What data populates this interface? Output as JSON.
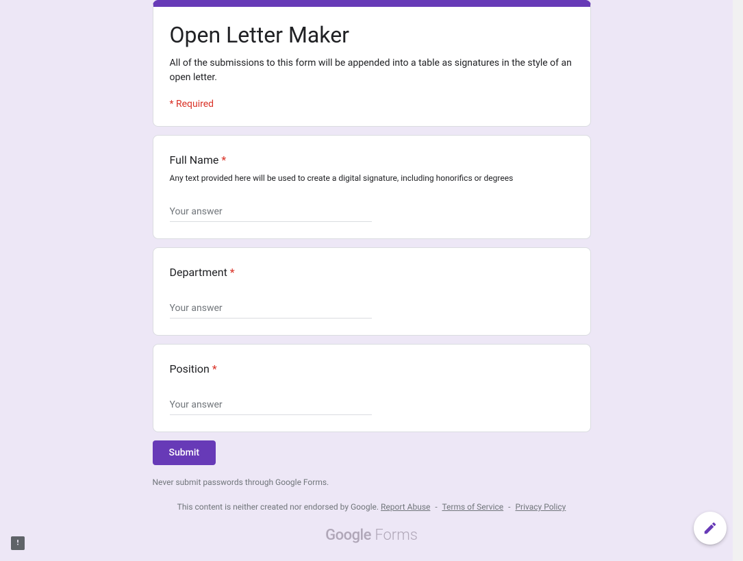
{
  "header": {
    "title": "Open Letter Maker",
    "description": "All of the submissions to this form will be appended into a table as signatures in the style of an open letter.",
    "required_note": "* Required"
  },
  "questions": [
    {
      "label": "Full Name",
      "required": true,
      "helper": "Any text provided here will be used to create a digital signature, including honorifics or degrees",
      "placeholder": "Your answer"
    },
    {
      "label": "Department",
      "required": true,
      "helper": "",
      "placeholder": "Your answer"
    },
    {
      "label": "Position",
      "required": true,
      "helper": "",
      "placeholder": "Your answer"
    }
  ],
  "actions": {
    "submit": "Submit"
  },
  "footer": {
    "warning": "Never submit passwords through Google Forms.",
    "disclaimer": "This content is neither created nor endorsed by Google.",
    "links": {
      "abuse": "Report Abuse",
      "terms": "Terms of Service",
      "privacy": "Privacy Policy"
    },
    "logo_google": "Google",
    "logo_forms": " Forms"
  },
  "asterisk": " *"
}
